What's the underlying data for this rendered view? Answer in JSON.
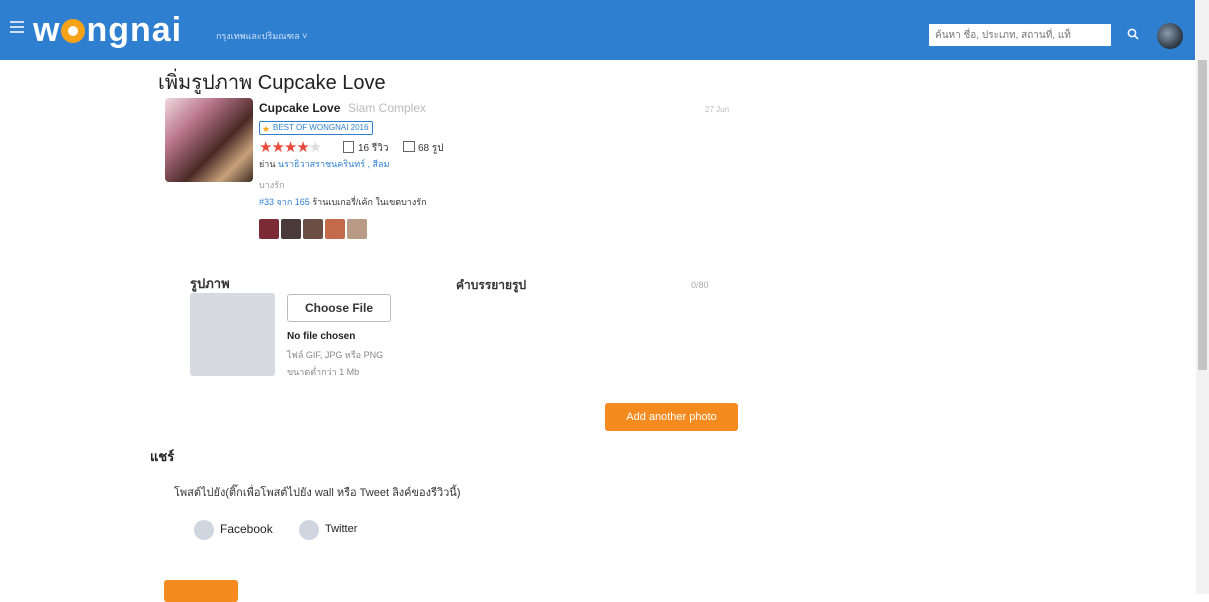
{
  "header": {
    "logo": "wongnai",
    "region": "กรุงเทพและปริมณฑล ˅",
    "search_placeholder": "ค้นหา ชื่อ, ประเภท, สถานที่, แท็",
    "icons": [
      "menu-icon",
      "search-icon",
      "avatar"
    ],
    "brand_color": "#2f7fd1"
  },
  "page": {
    "title": "เพิ่มรูปภาพ Cupcake Love"
  },
  "restaurant": {
    "name": "Cupcake Love",
    "branch": "Siam Complex",
    "time": "27 Jun",
    "badge": "BEST OF WONGNAI 2016",
    "rating_stars": 4,
    "rating_max": 5,
    "review_count": "16 รีวิว",
    "photo_count": "68 รูป",
    "category_prefix": "ย่าน",
    "category_links": "นราธิวาสราชนครินทร์ , สีลม",
    "district": "บางรัก",
    "rank_prefix": "#33 จาก 165",
    "rank_text": "ร้านเบเกอรี่/เค้ก ในเขตบางรัก",
    "thumb_colors": [
      "#7a2b35",
      "#4a3a3a",
      "#6b4f45",
      "#c26a4a",
      "#b89a86"
    ]
  },
  "form": {
    "photo_label": "รูปภาพ",
    "choose_file": "Choose File",
    "no_file": "No file chosen",
    "file_types": "ไฟล์ GIF, JPG หรือ PNG",
    "file_size": "ขนาดต่ำกว่า 1 Mb",
    "desc_label": "คำบรรยายรูป",
    "char_count": "0/80",
    "add_another": "Add another photo",
    "accent_color": "#f58a1f"
  },
  "share": {
    "title": "แชร์",
    "description": "โพสต์ไปยัง(ติ๊กเพื่อโพสต์ไปยัง wall หรือ Tweet ลิงค์ของรีวิวนี้)",
    "facebook": "Facebook",
    "twitter": "Twitter"
  }
}
